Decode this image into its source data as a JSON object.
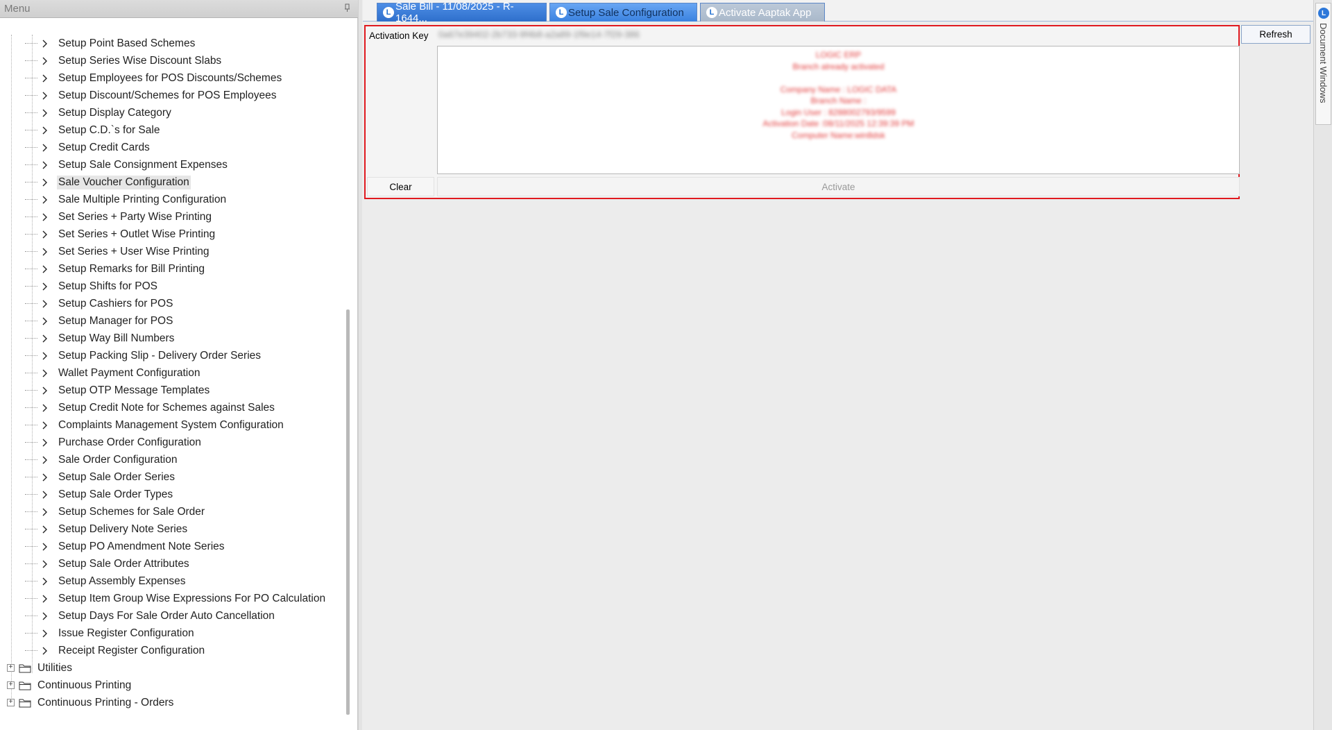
{
  "menu": {
    "title": "Menu",
    "items": [
      {
        "label": "Setup Point Based Schemes"
      },
      {
        "label": "Setup Series Wise Discount Slabs"
      },
      {
        "label": "Setup Employees for POS Discounts/Schemes"
      },
      {
        "label": "Setup Discount/Schemes for POS Employees"
      },
      {
        "label": "Setup Display Category"
      },
      {
        "label": "Setup C.D.`s for Sale"
      },
      {
        "label": "Setup Credit Cards"
      },
      {
        "label": "Setup Sale Consignment Expenses"
      },
      {
        "label": "Sale Voucher Configuration",
        "selected": true
      },
      {
        "label": "Sale Multiple Printing Configuration"
      },
      {
        "label": "Set Series + Party Wise Printing"
      },
      {
        "label": "Set Series + Outlet Wise Printing"
      },
      {
        "label": "Set Series + User Wise Printing"
      },
      {
        "label": "Setup Remarks for Bill Printing"
      },
      {
        "label": "Setup Shifts for POS"
      },
      {
        "label": "Setup Cashiers for POS"
      },
      {
        "label": "Setup Manager for POS"
      },
      {
        "label": "Setup Way Bill Numbers"
      },
      {
        "label": "Setup Packing Slip - Delivery Order Series"
      },
      {
        "label": "Wallet Payment Configuration"
      },
      {
        "label": "Setup OTP Message Templates"
      },
      {
        "label": "Setup Credit Note for Schemes against Sales"
      },
      {
        "label": "Complaints Management System Configuration"
      },
      {
        "label": "Purchase Order Configuration"
      },
      {
        "label": "Sale Order Configuration"
      },
      {
        "label": "Setup Sale Order Series"
      },
      {
        "label": "Setup Sale Order Types"
      },
      {
        "label": "Setup Schemes for Sale Order"
      },
      {
        "label": "Setup Delivery Note Series"
      },
      {
        "label": "Setup PO Amendment Note Series"
      },
      {
        "label": "Setup Sale Order Attributes"
      },
      {
        "label": "Setup Assembly Expenses"
      },
      {
        "label": "Setup Item Group Wise Expressions For PO Calculation"
      },
      {
        "label": "Setup Days For Sale Order Auto Cancellation"
      },
      {
        "label": "Issue Register Configuration"
      },
      {
        "label": "Receipt Register Configuration"
      }
    ],
    "folders": [
      {
        "label": "Utilities"
      },
      {
        "label": "Continuous Printing"
      },
      {
        "label": "Continuous Printing - Orders"
      }
    ]
  },
  "tabs": [
    {
      "label": "Sale Bill - 11/08/2025 - R-1644..."
    },
    {
      "label": "Setup Sale Configuration"
    },
    {
      "label": "Activate Aaptak App"
    }
  ],
  "activation": {
    "label": "Activation Key",
    "key_value": "0a67e39402-2b733-9f4b8-a2a89-1f9e14-7f29-386",
    "result_lines": [
      "LOGIC ERP",
      "Branch already activated",
      "",
      "Company Name : LOGIC DATA",
      "Branch Name :",
      "Login User : 8288002793/9599",
      "Activation Date :08/11/2025 12:39:39 PM",
      "Computer Name:win8dsk"
    ],
    "clear_label": "Clear",
    "activate_label": "Activate",
    "refresh_label": "Refresh"
  },
  "doc_windows": {
    "label": "Document Windows"
  },
  "colors": {
    "highlight_border": "#e0191f",
    "tab_active": "#2e6fcc",
    "tab_selected": "#3a82e0",
    "tab_inactive": "#a9b8ca"
  }
}
